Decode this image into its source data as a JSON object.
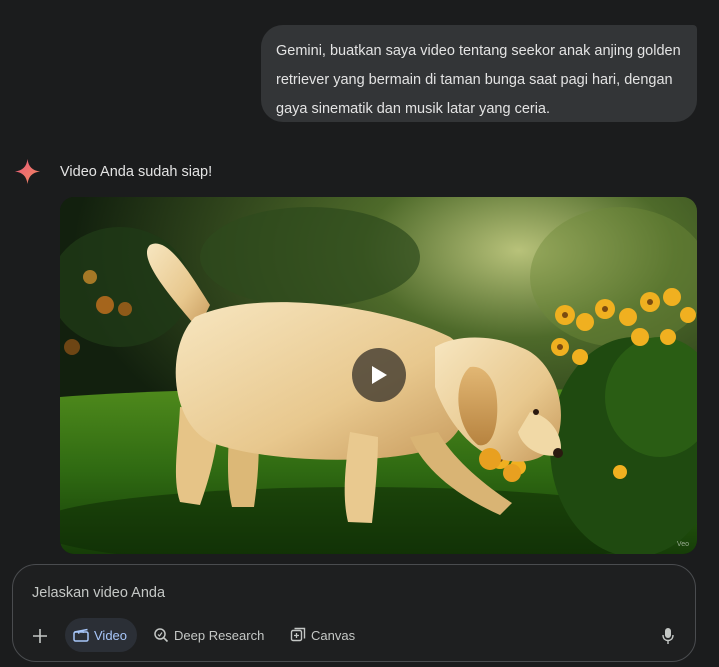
{
  "conversation": {
    "user_message": "Gemini, buatkan saya video tentang seekor anak anjing golden retriever yang bermain di taman bunga saat pagi hari, dengan gaya sinematik dan musik latar yang ceria.",
    "response_text": "Video Anda sudah siap!",
    "video": {
      "watermark": "Veo"
    }
  },
  "composer": {
    "placeholder": "Jelaskan video Anda",
    "tools": [
      {
        "label": "Video",
        "icon": "video-clapper-icon",
        "active": true
      },
      {
        "label": "Deep Research",
        "icon": "deep-research-icon",
        "active": false
      },
      {
        "label": "Canvas",
        "icon": "canvas-icon",
        "active": false
      }
    ],
    "add_icon": "plus-icon",
    "mic_icon": "microphone-icon"
  },
  "colors": {
    "background": "#1b1c1d",
    "user_bubble": "#333537",
    "accent": "#a8c7fa",
    "spark_gradient": [
      "#e8577a",
      "#f28b5f"
    ]
  }
}
